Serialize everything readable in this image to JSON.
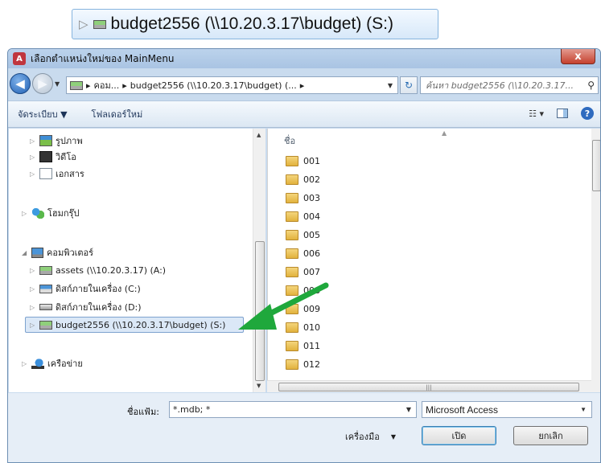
{
  "callout": {
    "label": "budget2556 (\\\\10.20.3.17\\budget) (S:)"
  },
  "window": {
    "title": "เลือกตำแหน่งใหม่ของ MainMenu",
    "close": "x"
  },
  "address": {
    "segments": [
      "คอม...",
      "budget2556 (\\\\10.20.3.17\\budget) (...",
      ""
    ],
    "search_placeholder": "ค้นหา budget2556 (\\\\10.20.3.17..."
  },
  "toolbar": {
    "organize": "จัดระเบียบ ▼",
    "new_folder": "โฟลเดอร์ใหม่"
  },
  "nav": {
    "libraries": [
      {
        "label": "รูปภาพ",
        "icon": "pictures-icon"
      },
      {
        "label": "วิดีโอ",
        "icon": "video-icon"
      },
      {
        "label": "เอกสาร",
        "icon": "document-icon"
      }
    ],
    "homegroup": "โฮมกรุ๊ป",
    "computer": "คอมพิวเตอร์",
    "drives": [
      {
        "label": "assets (\\\\10.20.3.17) (A:)",
        "icon": "network-drive-icon"
      },
      {
        "label": "ดิสก์ภายในเครื่อง (C:)",
        "icon": "windows-drive-icon"
      },
      {
        "label": "ดิสก์ภายในเครื่อง (D:)",
        "icon": "drive-icon"
      },
      {
        "label": "budget2556 (\\\\10.20.3.17\\budget) (S:)",
        "icon": "network-drive-icon"
      }
    ],
    "network": "เครือข่าย"
  },
  "files": {
    "column_name": "ชื่อ",
    "items": [
      "001",
      "002",
      "003",
      "004",
      "005",
      "006",
      "007",
      "008",
      "009",
      "010",
      "011",
      "012"
    ]
  },
  "bottom": {
    "filename_label": "ชื่อแฟ้ม:",
    "filename_value": "*.mdb; *",
    "filetype_value": "Microsoft Access",
    "tools": "เครื่องมือ",
    "open": "เปิด",
    "cancel": "ยกเลิก"
  },
  "annotation": {
    "arrow_color": "#1fa83c"
  }
}
